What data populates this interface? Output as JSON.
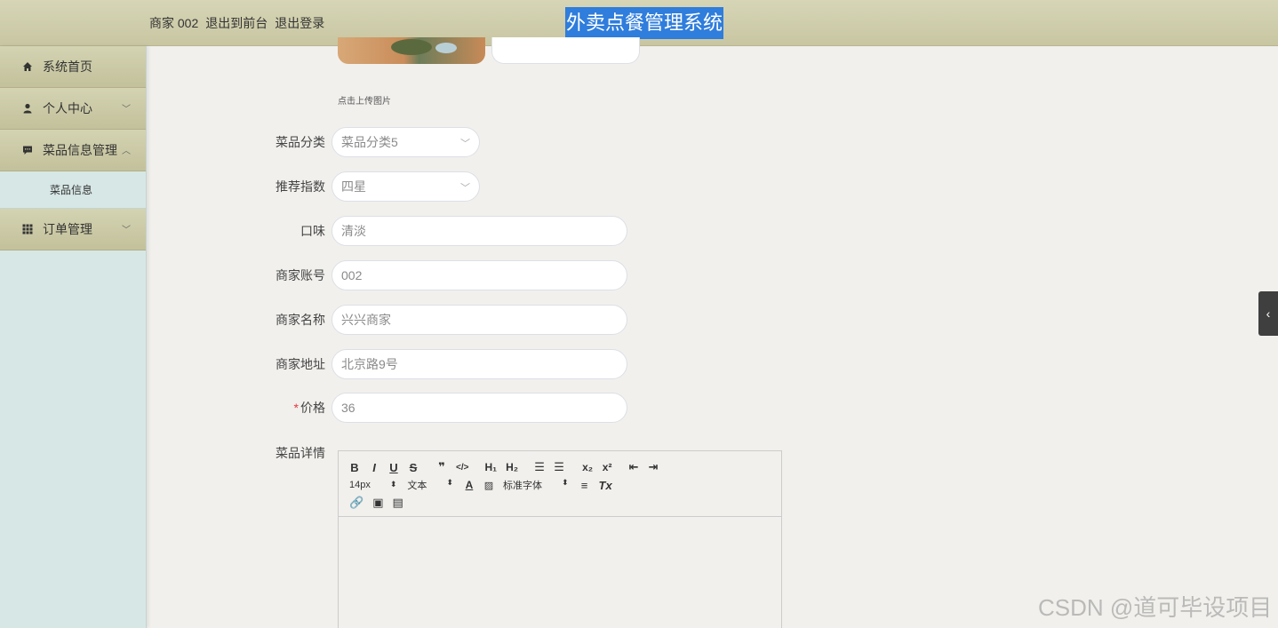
{
  "header": {
    "merchant": "商家 002",
    "to_front": "退出到前台",
    "logout": "退出登录",
    "title": "外卖点餐管理系统",
    "title_bg": "#2f7ddc"
  },
  "sidebar": {
    "items": [
      {
        "label": "系统首页",
        "icon": "home-icon"
      },
      {
        "label": "个人中心",
        "icon": "user-icon",
        "chevron": "down"
      },
      {
        "label": "菜品信息管理",
        "icon": "chat-icon",
        "chevron": "up",
        "expanded": true
      },
      {
        "label": "订单管理",
        "icon": "grid-icon",
        "chevron": "down"
      }
    ],
    "subitems": [
      "菜品信息"
    ]
  },
  "form": {
    "upload_tip": "点击上传图片",
    "category": {
      "label": "菜品分类",
      "value": "菜品分类5"
    },
    "rating": {
      "label": "推荐指数",
      "value": "四星"
    },
    "taste": {
      "label": "口味",
      "value": "清淡"
    },
    "account": {
      "label": "商家账号",
      "value": "002"
    },
    "merchant_name": {
      "label": "商家名称",
      "value": "兴兴商家"
    },
    "address": {
      "label": "商家地址",
      "value": "北京路9号"
    },
    "price": {
      "label": "价格",
      "required_mark": "*",
      "value": "36"
    },
    "detail_label": "菜品详情"
  },
  "editor": {
    "font_size": "14px",
    "block_type": "文本",
    "font_family": "标准字体"
  },
  "watermark": "CSDN @道可毕设项目"
}
